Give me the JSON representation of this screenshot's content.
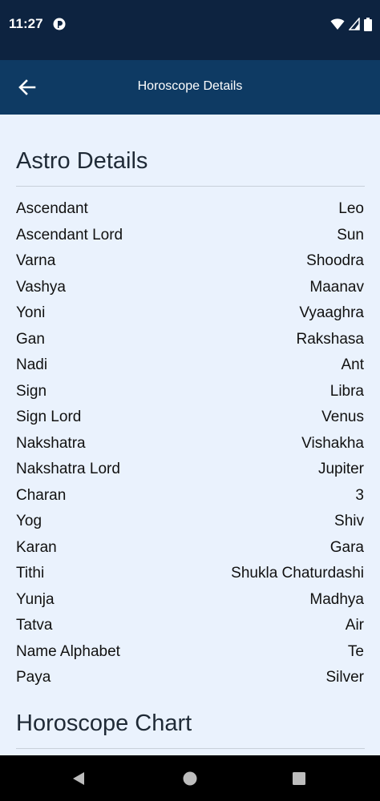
{
  "status_bar": {
    "time": "11:27"
  },
  "app_bar": {
    "title": "Horoscope Details"
  },
  "astro_section": {
    "title": "Astro Details"
  },
  "details": [
    {
      "label": "Ascendant",
      "value": "Leo"
    },
    {
      "label": "Ascendant Lord",
      "value": "Sun"
    },
    {
      "label": "Varna",
      "value": "Shoodra"
    },
    {
      "label": "Vashya",
      "value": "Maanav"
    },
    {
      "label": "Yoni",
      "value": "Vyaaghra"
    },
    {
      "label": "Gan",
      "value": "Rakshasa"
    },
    {
      "label": "Nadi",
      "value": "Ant"
    },
    {
      "label": "Sign",
      "value": "Libra"
    },
    {
      "label": "Sign Lord",
      "value": "Venus"
    },
    {
      "label": "Nakshatra",
      "value": "Vishakha"
    },
    {
      "label": "Nakshatra Lord",
      "value": "Jupiter"
    },
    {
      "label": "Charan",
      "value": "3"
    },
    {
      "label": "Yog",
      "value": "Shiv"
    },
    {
      "label": "Karan",
      "value": "Gara"
    },
    {
      "label": "Tithi",
      "value": "Shukla Chaturdashi"
    },
    {
      "label": "Yunja",
      "value": "Madhya"
    },
    {
      "label": "Tatva",
      "value": "Air"
    },
    {
      "label": "Name Alphabet",
      "value": "Te"
    },
    {
      "label": "Paya",
      "value": "Silver"
    }
  ],
  "chart_section": {
    "title": "Horoscope Chart"
  },
  "colors": {
    "status_bar": "#0d2340",
    "app_bar": "#0e3a63",
    "background": "#eaf2fd"
  },
  "icons": {
    "back": "arrow-left-icon",
    "wifi": "wifi-icon",
    "signal": "signal-icon",
    "battery": "battery-icon"
  }
}
